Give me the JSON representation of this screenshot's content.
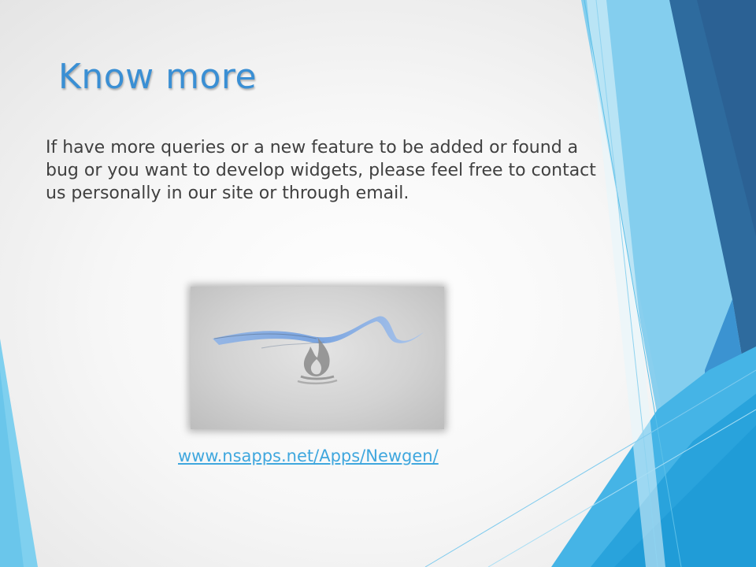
{
  "slide": {
    "title": "Know more",
    "body": "If have more queries or a new feature to be added or found a bug or you want to develop widgets, please feel free to contact us personally in our site or through email.",
    "link": "www.nsapps.net/Apps/Newgen/"
  },
  "colors": {
    "title": "#3a8fd4",
    "body_text": "#404040",
    "link": "#3fa7de",
    "accent_dark_blue": "#2e6b9e",
    "accent_light_blue": "#5bc0e8"
  },
  "icons": {
    "logo": "newgen-flame-ribbon-logo"
  }
}
